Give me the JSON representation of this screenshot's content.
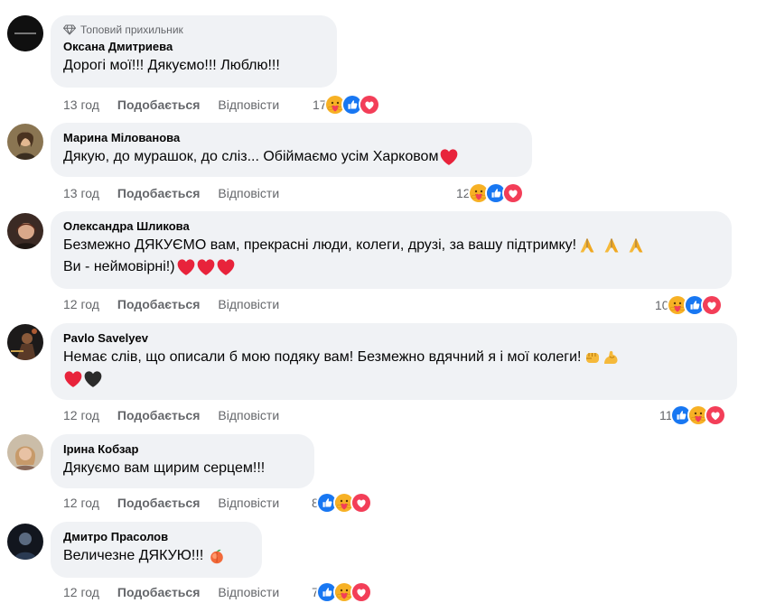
{
  "comments": [
    {
      "badge": "Топовий прихильник",
      "author": "Оксана Дмитриева",
      "lines": [
        "Дорогі мої!!! Дякуємо!!! Люблю!!!"
      ],
      "time": "13 год",
      "like": "Подобається",
      "reply": "Відповісти",
      "count": "17",
      "reactions": [
        "care",
        "like",
        "love"
      ],
      "avatar_color": "#111111"
    },
    {
      "author": "Марина Мілованова",
      "lines": [
        "Дякую, до мурашок, до сліз... Обіймаємо усім Харковом"
      ],
      "time": "13 год",
      "like": "Подобається",
      "reply": "Відповісти",
      "count": "12",
      "reactions": [
        "care",
        "like",
        "love"
      ],
      "avatar_color": "#6b5a3e"
    },
    {
      "author": "Олександра Шликова",
      "lines": [
        "Безмежно ДЯКУЄМО вам, прекрасні люди, колеги, друзі, за вашу підтримку!",
        "Ви - неймовірні!)"
      ],
      "time": "12 год",
      "like": "Подобається",
      "reply": "Відповісти",
      "count": "10",
      "reactions": [
        "care",
        "like",
        "love"
      ],
      "avatar_color": "#3a2a22"
    },
    {
      "author": "Pavlo Savelyev",
      "lines": [
        "Немає слів, що описали б мою подяку вам! Безмежно вдячний я і мої колеги!",
        ""
      ],
      "time": "12 год",
      "like": "Подобається",
      "reply": "Відповісти",
      "count": "11",
      "reactions": [
        "like",
        "care",
        "love"
      ],
      "avatar_color": "#2a2420"
    },
    {
      "author": "Ірина Кобзар",
      "lines": [
        "Дякуємо вам щирим серцем!!!"
      ],
      "time": "12 год",
      "like": "Подобається",
      "reply": "Відповісти",
      "count": "8",
      "reactions": [
        "like",
        "care",
        "love"
      ],
      "avatar_color": "#b9a28a"
    },
    {
      "author": "Дмитро Прасолов",
      "lines": [
        "Величезне ДЯКУЮ!!!"
      ],
      "time": "12 год",
      "like": "Подобається",
      "reply": "Відповісти",
      "count": "7",
      "reactions": [
        "like",
        "care",
        "love"
      ],
      "avatar_color": "#1f2a3a"
    }
  ],
  "colors": {
    "bubble": "#f0f2f5",
    "secondary_text": "#65676b",
    "like_blue": "#1877f2",
    "love_red": "#f33e58",
    "care_yellow": "#f7b125"
  }
}
